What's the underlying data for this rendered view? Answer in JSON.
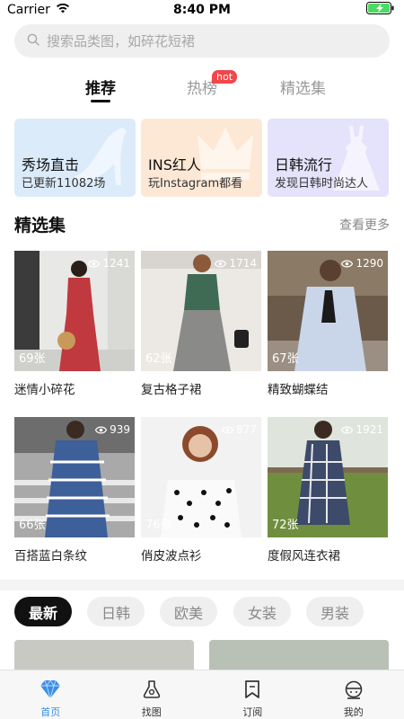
{
  "status_bar": {
    "carrier": "Carrier",
    "time": "8:40 PM"
  },
  "search": {
    "placeholder": "搜索品类图，如碎花短裙"
  },
  "tabs": [
    {
      "label": "推荐",
      "active": true
    },
    {
      "label": "热榜",
      "badge": "hot"
    },
    {
      "label": "精选集"
    }
  ],
  "feature_cards": [
    {
      "title": "秀场直击",
      "subtitle": "已更新11082场",
      "bg": "#dcebfa",
      "icon": "high-heel-icon"
    },
    {
      "title": "INS红人",
      "subtitle": "玩Instagram都看",
      "bg": "#fde8d6",
      "icon": "crown-icon"
    },
    {
      "title": "日韩流行",
      "subtitle": "发现日韩时尚达人",
      "bg": "#e5e2fb",
      "icon": "dress-icon"
    }
  ],
  "collections": {
    "title": "精选集",
    "more": "查看更多",
    "items": [
      {
        "caption": "迷情小碎花",
        "views": "1241",
        "count": "69张"
      },
      {
        "caption": "复古格子裙",
        "views": "1714",
        "count": "62张"
      },
      {
        "caption": "精致蝴蝶结",
        "views": "1290",
        "count": "67张"
      },
      {
        "caption": "百搭蓝白条纹",
        "views": "939",
        "count": "66张"
      },
      {
        "caption": "俏皮波点衫",
        "views": "877",
        "count": "76张"
      },
      {
        "caption": "度假风连衣裙",
        "views": "1921",
        "count": "72张"
      }
    ]
  },
  "categories": [
    {
      "label": "最新",
      "active": true
    },
    {
      "label": "日韩"
    },
    {
      "label": "欧美"
    },
    {
      "label": "女装"
    },
    {
      "label": "男装"
    }
  ],
  "bottom_nav": [
    {
      "label": "首页",
      "icon": "diamond-icon",
      "active": true
    },
    {
      "label": "找图",
      "icon": "find-image-icon"
    },
    {
      "label": "订阅",
      "icon": "bookmark-icon"
    },
    {
      "label": "我的",
      "icon": "profile-icon"
    }
  ],
  "colors": {
    "accent": "#3a8ee6",
    "hot": "#f0474a",
    "battery": "#4cd964"
  }
}
